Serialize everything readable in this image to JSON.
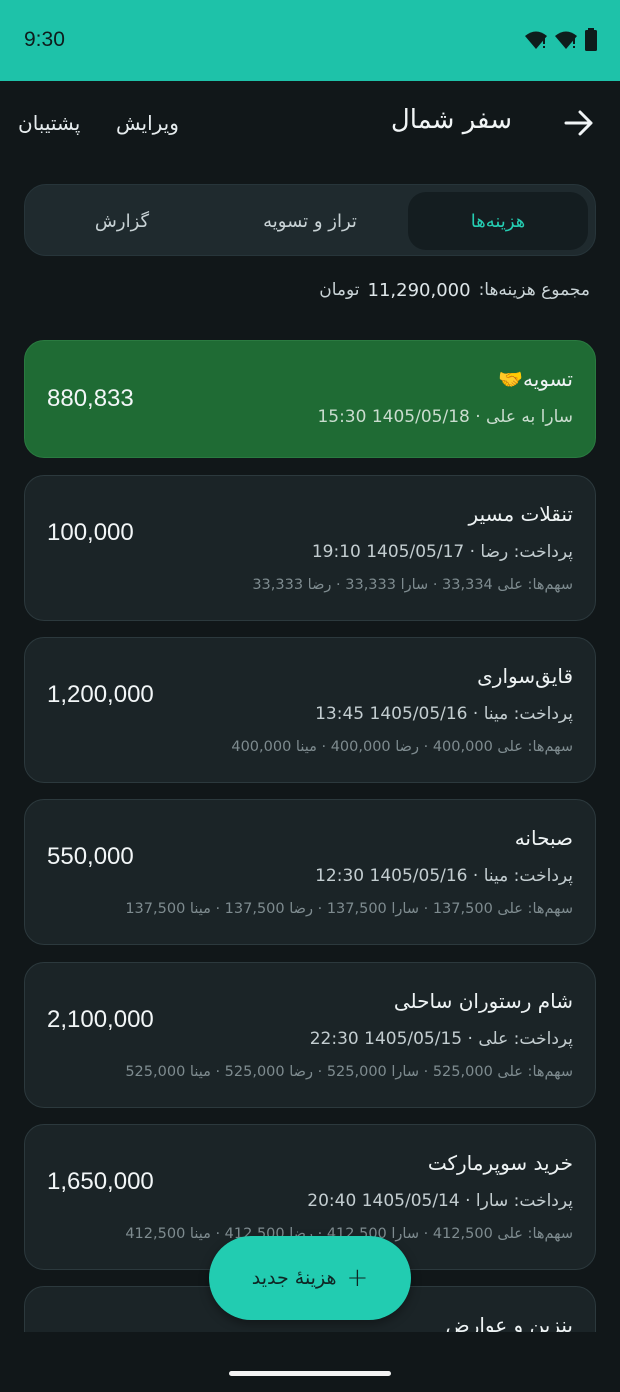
{
  "status_bar": {
    "time": "9:30",
    "icons": [
      "wifi-icon",
      "wifi-icon",
      "battery-icon"
    ]
  },
  "header": {
    "title": "سفر شمال",
    "edit_label": "ویرایش",
    "support_label": "پشتیبان",
    "back_icon": "arrow-right-icon"
  },
  "tabs": [
    {
      "label": "هزینه‌ها",
      "active": true
    },
    {
      "label": "تراز و تسویه",
      "active": false
    },
    {
      "label": "گزارش",
      "active": false
    }
  ],
  "summary": {
    "label": "مجموع هزینه‌ها:",
    "amount": "11,290,000",
    "unit": "تومان"
  },
  "expenses": [
    {
      "type": "settlement",
      "icon": "🤝",
      "title": "تسویه",
      "meta": "سارا به علی · 1405/05/18 15:30",
      "amount": "880,833"
    },
    {
      "type": "expense",
      "title": "تنقلات مسیر",
      "meta": "پرداخت: رضا · 1405/05/17 19:10",
      "shares": "سهم‌ها: علی 33,334 · سارا 33,333 · رضا 33,333",
      "amount": "100,000"
    },
    {
      "type": "expense",
      "title": "قایق‌سواری",
      "meta": "پرداخت: مینا · 1405/05/16 13:45",
      "shares": "سهم‌ها: علی 400,000 · رضا 400,000 · مینا 400,000",
      "amount": "1,200,000"
    },
    {
      "type": "expense",
      "title": "صبحانه",
      "meta": "پرداخت: مینا · 1405/05/16 12:30",
      "shares": "سهم‌ها: علی 137,500 · سارا 137,500 · رضا 137,500 · مینا 137,500",
      "amount": "550,000"
    },
    {
      "type": "expense",
      "title": "شام رستوران ساحلی",
      "meta": "پرداخت: علی · 1405/05/15 22:30",
      "shares": "سهم‌ها: علی 525,000 · سارا 525,000 · رضا 525,000 · مینا 525,000",
      "amount": "2,100,000"
    },
    {
      "type": "expense",
      "title": "خرید سوپرمارکت",
      "meta": "پرداخت: سارا · 1405/05/14 20:40",
      "shares": "سهم‌ها: علی 412,500 · سارا 412,500 · رضا 412,500 · مینا 412,500",
      "amount": "1,650,000"
    },
    {
      "type": "expense",
      "title": "بنزین و عوارض",
      "meta": "",
      "shares": "",
      "amount": ""
    }
  ],
  "fab": {
    "label": "هزینهٔ جدید",
    "icon": "plus-icon"
  },
  "colors": {
    "accent": "#22ccb1",
    "settlement_bg": "#1f6b34",
    "background": "#111719",
    "card_bg": "#1b2427"
  }
}
